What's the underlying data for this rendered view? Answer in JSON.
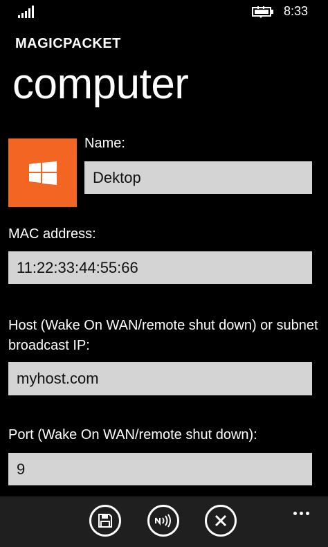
{
  "status_bar": {
    "time": "8:33"
  },
  "header": {
    "app_name": "MAGICPACKET",
    "page_title": "computer"
  },
  "tile": {
    "icon": "windows-logo-icon",
    "color": "#f26522"
  },
  "form": {
    "name_label": "Name:",
    "name_value": "Dektop",
    "mac_label": "MAC address:",
    "mac_value": "11:22:33:44:55:66",
    "host_label": "Host (Wake On WAN/remote shut down) or subnet broadcast IP:",
    "host_value": "myhost.com",
    "port_label": "Port (Wake On WAN/remote shut down):",
    "port_value": "9"
  },
  "app_bar": {
    "buttons": [
      {
        "icon": "save-icon"
      },
      {
        "icon": "nfc-icon"
      },
      {
        "icon": "cancel-icon"
      }
    ],
    "more": "more-icon"
  }
}
